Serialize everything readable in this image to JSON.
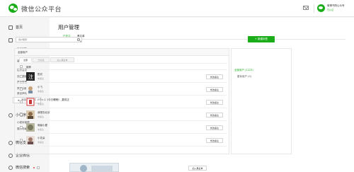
{
  "header": {
    "brand": "微信公众平台",
    "account_name": "微博书院公众号",
    "account_sub": "已认证"
  },
  "sidebar": {
    "home": "首页",
    "features": "功能",
    "feature_items": [
      "自动回复",
      "自定义菜单",
      "留言管理",
      "投票管理",
      "页面模版",
      "原创管理",
      "赞赏功能",
      "原创声明"
    ],
    "add_plugin": "添加功能插件",
    "mini_program": "小程序",
    "mini_items": [
      "小程序管理",
      "展示场景"
    ],
    "wechat_pay": "微信支付",
    "enterprise": "企业微信",
    "wechat_search": "微信搜索"
  },
  "main": {
    "title": "用户管理",
    "tabs": [
      "已关注",
      "黑名单"
    ],
    "search_placeholder": "用户昵称",
    "new_tag_button": "+ 新建标签",
    "list_header": "全部用户",
    "sub_tabs": [
      "全部",
      "已标签",
      "加入黑名单"
    ],
    "column_nickname": "昵称",
    "remark_button": "修改备注",
    "add_black_button": "加入黑名单",
    "rows": [
      {
        "name": "阳光",
        "remark": "未备注"
      },
      {
        "name": "小飞",
        "remark": "未备注"
      },
      {
        "name": "jYT>-1《今日睡眠》_要成正",
        "remark": "未备注"
      },
      {
        "name": "我想去北京",
        "remark": "未备注"
      },
      {
        "name": "瑜伽小屋",
        "remark": "未备注"
      },
      {
        "name": "小花朵",
        "remark": "未备注"
      }
    ]
  },
  "tags_panel": {
    "all": "全部用户 (1223)",
    "star": "星标用户 (0)"
  },
  "colors": {
    "accent": "#1aad19",
    "background": "#f5f5f5"
  }
}
